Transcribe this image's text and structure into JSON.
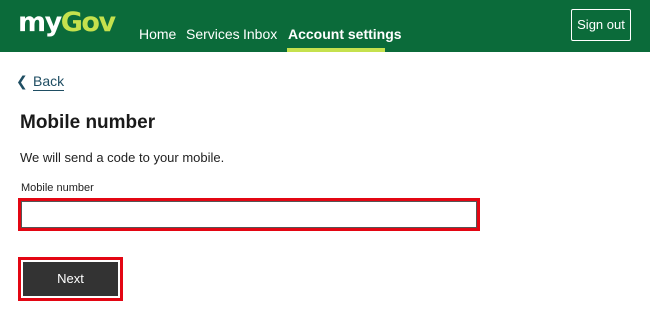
{
  "header": {
    "logo": {
      "part1": "my",
      "part2": "Gov"
    },
    "nav": [
      {
        "label": "Home"
      },
      {
        "label": "Services"
      },
      {
        "label": "Inbox"
      },
      {
        "label": "Account settings",
        "active": true
      }
    ],
    "sign_out_label": "Sign out"
  },
  "main": {
    "back_label": "Back",
    "title": "Mobile number",
    "intro": "We will send a code to your mobile.",
    "field_label": "Mobile number",
    "field_value": "",
    "next_label": "Next"
  },
  "colors": {
    "header_bg": "#0b6b3a",
    "logo_accent": "#c5e14d",
    "highlight": "#e30613",
    "button_bg": "#333333",
    "link": "#1f4e63"
  },
  "icons": {
    "back": "chevron-left-icon"
  }
}
